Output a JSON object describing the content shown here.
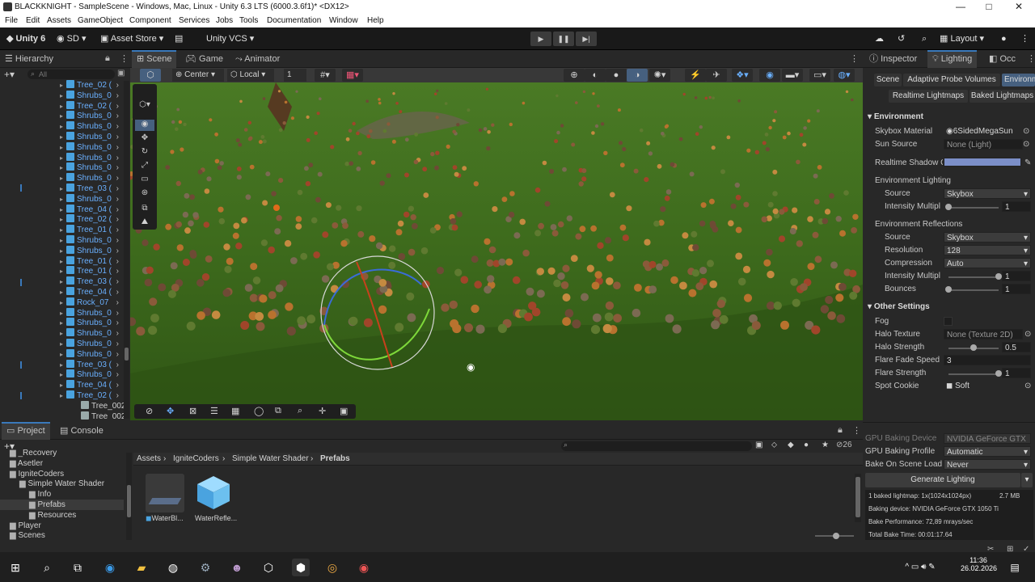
{
  "window": {
    "title": "BLACKKNIGHT - SampleScene - Windows, Mac, Linux - Unity 6.3 LTS (6000.3.6f1)* <DX12>",
    "minimize": "—",
    "maximize": "□",
    "close": "✕"
  },
  "menu": [
    "File",
    "Edit",
    "Assets",
    "GameObject",
    "Component",
    "Services",
    "Jobs",
    "Tools",
    "Documentation",
    "Window",
    "Help"
  ],
  "toolbar": {
    "unity": "Unity 6",
    "account": "SD",
    "asset_store": "Asset Store",
    "vcs": "Unity VCS",
    "layout": "Layout"
  },
  "hierarchy": {
    "tab": "Hierarchy",
    "search_placeholder": "All",
    "items": [
      {
        "name": "Tree_02 (",
        "indent": 1
      },
      {
        "name": "Shrubs_0",
        "indent": 1
      },
      {
        "name": "Tree_02 (",
        "indent": 1
      },
      {
        "name": "Shrubs_0",
        "indent": 1
      },
      {
        "name": "Shrubs_0",
        "indent": 1
      },
      {
        "name": "Shrubs_0",
        "indent": 1
      },
      {
        "name": "Shrubs_0",
        "indent": 1
      },
      {
        "name": "Shrubs_0",
        "indent": 1
      },
      {
        "name": "Shrubs_0",
        "indent": 1
      },
      {
        "name": "Shrubs_0",
        "indent": 1
      },
      {
        "name": "Tree_03 (",
        "indent": 1
      },
      {
        "name": "Shrubs_0",
        "indent": 1
      },
      {
        "name": "Tree_04 (",
        "indent": 1
      },
      {
        "name": "Tree_02 (",
        "indent": 1
      },
      {
        "name": "Tree_01 (",
        "indent": 1
      },
      {
        "name": "Shrubs_0",
        "indent": 1
      },
      {
        "name": "Shrubs_0",
        "indent": 1
      },
      {
        "name": "Tree_01 (",
        "indent": 1
      },
      {
        "name": "Tree_01 (",
        "indent": 1
      },
      {
        "name": "Tree_03 (",
        "indent": 1
      },
      {
        "name": "Tree_04 (",
        "indent": 1
      },
      {
        "name": "Rock_07",
        "indent": 1
      },
      {
        "name": "Shrubs_0",
        "indent": 1
      },
      {
        "name": "Shrubs_0",
        "indent": 1
      },
      {
        "name": "Shrubs_0",
        "indent": 1
      },
      {
        "name": "Shrubs_0",
        "indent": 1
      },
      {
        "name": "Shrubs_0",
        "indent": 1
      },
      {
        "name": "Tree_03 (",
        "indent": 1
      },
      {
        "name": "Shrubs_0",
        "indent": 1
      },
      {
        "name": "Tree_04 (",
        "indent": 1
      },
      {
        "name": "Tree_02 (",
        "indent": 1
      },
      {
        "name": "Tree_002",
        "indent": 2
      },
      {
        "name": "Tree_002",
        "indent": 2
      }
    ]
  },
  "scene": {
    "tabs": [
      "Scene",
      "Game",
      "Animator"
    ],
    "pivot": "Center",
    "space": "Local",
    "snap": "1"
  },
  "inspector": {
    "tabs": [
      "Inspector",
      "Lighting",
      "Occ"
    ],
    "subtabs": [
      "Scene",
      "Adaptive Probe Volumes",
      "Environm"
    ],
    "subtabs2": [
      "Realtime Lightmaps",
      "Baked Lightmaps"
    ],
    "environment": "Environment",
    "skybox_material": {
      "label": "Skybox Material",
      "value": "6SidedMegaSun"
    },
    "sun_source": {
      "label": "Sun Source",
      "value": "None (Light)"
    },
    "realtime_shadow": {
      "label": "Realtime Shadow C",
      "color": "#7c8fc8"
    },
    "env_lighting": "Environment Lighting",
    "el_source": {
      "label": "Source",
      "value": "Skybox"
    },
    "el_intensity": {
      "label": "Intensity Multipl",
      "value": "1",
      "fraction": 0.0
    },
    "env_reflections": "Environment Reflections",
    "er_source": {
      "label": "Source",
      "value": "Skybox"
    },
    "er_resolution": {
      "label": "Resolution",
      "value": "128"
    },
    "er_compression": {
      "label": "Compression",
      "value": "Auto"
    },
    "er_intensity": {
      "label": "Intensity Multipl",
      "value": "1",
      "fraction": 1.0
    },
    "er_bounces": {
      "label": "Bounces",
      "value": "1",
      "fraction": 0.0
    },
    "other": "Other Settings",
    "fog": {
      "label": "Fog"
    },
    "halo_texture": {
      "label": "Halo Texture",
      "value": "None (Texture 2D)"
    },
    "halo_strength": {
      "label": "Halo Strength",
      "value": "0.5",
      "fraction": 0.5
    },
    "flare_fade": {
      "label": "Flare Fade Speed",
      "value": "3"
    },
    "flare_strength": {
      "label": "Flare Strength",
      "value": "1",
      "fraction": 1.0
    },
    "spot_cookie": {
      "label": "Spot Cookie",
      "value": "Soft"
    },
    "gpu_device": {
      "label": "GPU Baking Device",
      "value": "NVIDIA GeForce GTX"
    },
    "gpu_profile": {
      "label": "GPU Baking Profile",
      "value": "Automatic"
    },
    "bake_on_load": {
      "label": "Bake On Scene Load",
      "value": "Never"
    },
    "generate": "Generate Lighting",
    "stats": [
      "1 baked lightmap: 1x(1024x1024px)",
      "Baking device: NVIDIA GeForce GTX 1050 Ti",
      "Bake Performance: 72,89 mrays/sec",
      "Total Bake Time: 00:01:17.64"
    ],
    "stats_size": "2.7 MB"
  },
  "project": {
    "tabs": [
      "Project",
      "Console"
    ],
    "badge": "26",
    "tree": [
      {
        "name": "_Recovery",
        "indent": 1
      },
      {
        "name": "Asetler",
        "indent": 1
      },
      {
        "name": "IgniteCoders",
        "indent": 1
      },
      {
        "name": "Simple Water Shader",
        "indent": 2
      },
      {
        "name": "Info",
        "indent": 3
      },
      {
        "name": "Prefabs",
        "indent": 3
      },
      {
        "name": "Resources",
        "indent": 3
      },
      {
        "name": "Player",
        "indent": 1
      },
      {
        "name": "Scenes",
        "indent": 1
      }
    ],
    "breadcrumb": [
      "Assets",
      "IgniteCoders",
      "Simple Water Shader",
      "Prefabs"
    ],
    "assets": [
      "WaterBl...",
      "WaterRefle..."
    ]
  },
  "taskbar": {
    "time": "11:36",
    "date": "26.02.2026"
  },
  "colors": {
    "accent": "#3a79bb",
    "cube": "#4aa3df",
    "terrain": "#3f6a1c"
  }
}
